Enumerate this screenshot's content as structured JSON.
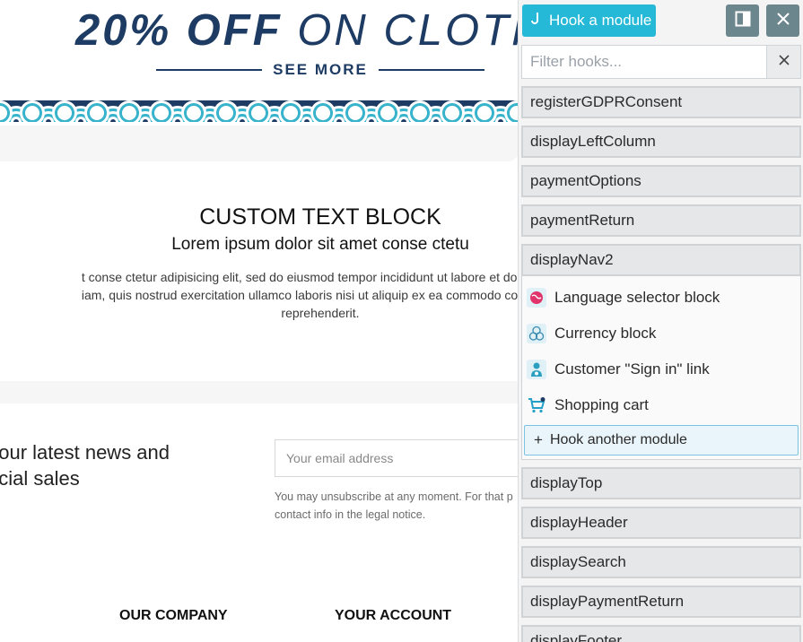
{
  "banner": {
    "promo_bold": "20% OFF",
    "promo_rest": "ON CLOTHI",
    "see_more": "SEE MORE"
  },
  "text_block": {
    "title": "CUSTOM TEXT BLOCK",
    "subtitle": "Lorem ipsum dolor sit amet conse ctetu",
    "line1": "t conse ctetur adipisicing elit, sed do eiusmod tempor incididunt ut labore et dolore ma",
    "line2": "iam, quis nostrud exercitation ullamco laboris nisi ut aliquip ex ea commodo consequa",
    "line3": "reprehenderit."
  },
  "newsletter": {
    "title_line1": "t our latest news and",
    "title_line2": "ecial sales",
    "email_placeholder": "Your email address",
    "note_line1": "You may unsubscribe at any moment. For that p",
    "note_line2": "contact info in the legal notice."
  },
  "footer": {
    "col1": "OUR COMPANY",
    "col2": "YOUR ACCOUNT"
  },
  "panel": {
    "hook_button": "Hook a module",
    "hook_button_icon": "hook-icon",
    "filter_placeholder": "Filter hooks...",
    "hooks_before": [
      {
        "label": "registerGDPRConsent"
      },
      {
        "label": "displayLeftColumn"
      },
      {
        "label": "paymentOptions"
      },
      {
        "label": "paymentReturn"
      }
    ],
    "open_hook": {
      "label": "displayNav2",
      "modules": [
        {
          "label": "Language selector block",
          "icon": "globe-icon"
        },
        {
          "label": "Currency block",
          "icon": "currency-icon"
        },
        {
          "label": "Customer \"Sign in\" link",
          "icon": "user-icon"
        },
        {
          "label": "Shopping cart",
          "icon": "cart-icon"
        }
      ],
      "hook_another": "Hook another module"
    },
    "hooks_after": [
      {
        "label": "displayTop"
      },
      {
        "label": "displayHeader"
      },
      {
        "label": "displaySearch"
      },
      {
        "label": "displayPaymentReturn"
      },
      {
        "label": "displayFooter"
      }
    ]
  },
  "colors": {
    "primary": "#25b9d7",
    "secondary_button": "#6c868e",
    "navy": "#1d3b63"
  }
}
